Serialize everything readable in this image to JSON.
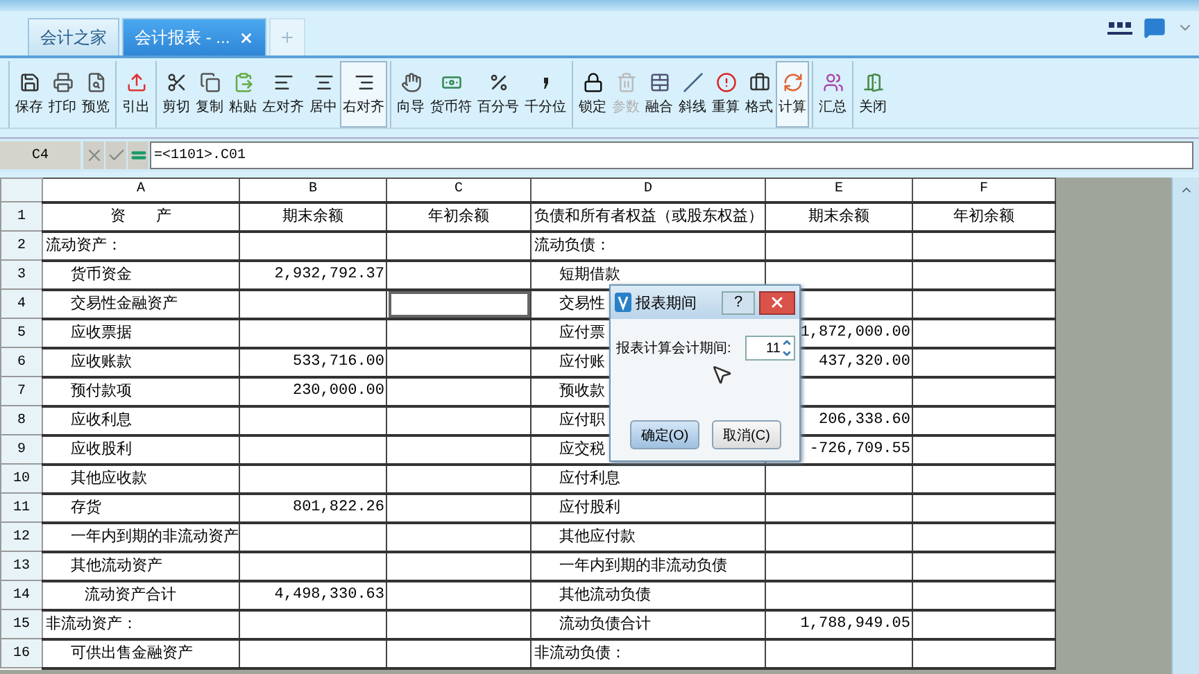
{
  "tabs": [
    {
      "label": "会计之家",
      "selected": false,
      "closable": false
    },
    {
      "label": "会计报表 - ...",
      "selected": true,
      "closable": true
    }
  ],
  "toolbar": [
    [
      {
        "label": "保存",
        "selected": false,
        "disabled": false
      },
      {
        "label": "打印",
        "selected": false,
        "disabled": false
      },
      {
        "label": "预览",
        "selected": false,
        "disabled": false
      }
    ],
    [
      {
        "label": "引出",
        "selected": false,
        "disabled": false
      }
    ],
    [
      {
        "label": "剪切",
        "selected": false,
        "disabled": false
      },
      {
        "label": "复制",
        "selected": false,
        "disabled": false
      },
      {
        "label": "粘贴",
        "selected": false,
        "disabled": false
      },
      {
        "label": "左对齐",
        "selected": false,
        "disabled": false
      },
      {
        "label": "居中",
        "selected": false,
        "disabled": false
      },
      {
        "label": "右对齐",
        "selected": true,
        "disabled": false
      }
    ],
    [
      {
        "label": "向导",
        "selected": false,
        "disabled": false
      },
      {
        "label": "货币符",
        "selected": false,
        "disabled": false
      },
      {
        "label": "百分号",
        "selected": false,
        "disabled": false
      },
      {
        "label": "千分位",
        "selected": false,
        "disabled": false
      }
    ],
    [
      {
        "label": "锁定",
        "selected": false,
        "disabled": false
      },
      {
        "label": "参数",
        "selected": false,
        "disabled": true
      },
      {
        "label": "融合",
        "selected": false,
        "disabled": false
      },
      {
        "label": "斜线",
        "selected": false,
        "disabled": false
      },
      {
        "label": "重算",
        "selected": false,
        "disabled": false
      },
      {
        "label": "格式",
        "selected": false,
        "disabled": false
      },
      {
        "label": "计算",
        "selected": true,
        "disabled": false
      }
    ],
    [
      {
        "label": "汇总",
        "selected": false,
        "disabled": false
      }
    ],
    [
      {
        "label": "关闭",
        "selected": false,
        "disabled": false
      }
    ]
  ],
  "formula_bar": {
    "cell_ref": "C4",
    "formula": "=<1101>.C01"
  },
  "columns": [
    "A",
    "B",
    "C",
    "D",
    "E",
    "F"
  ],
  "rows": [
    {
      "num": "1",
      "cells": [
        {
          "text": "资　　产",
          "kind": "header",
          "selected": false
        },
        {
          "text": "期末余额",
          "kind": "header",
          "selected": false
        },
        {
          "text": "年初余额",
          "kind": "header",
          "selected": false
        },
        {
          "text": "负债和所有者权益（或股东权益）",
          "kind": "header",
          "selected": false
        },
        {
          "text": "期末余额",
          "kind": "header",
          "selected": false
        },
        {
          "text": "年初余额",
          "kind": "header",
          "selected": false
        }
      ]
    },
    {
      "num": "2",
      "cells": [
        {
          "text": "流动资产：",
          "kind": "section",
          "selected": false
        },
        {
          "kind": "number",
          "selected": false
        },
        {
          "kind": "number",
          "selected": false
        },
        {
          "text": "流动负债：",
          "kind": "section",
          "selected": false
        },
        {
          "kind": "number",
          "selected": false
        },
        {
          "kind": "number",
          "selected": false
        }
      ]
    },
    {
      "num": "3",
      "cells": [
        {
          "text": "货币资金",
          "kind": "item",
          "selected": false
        },
        {
          "text": "2,932,792.37",
          "kind": "number",
          "selected": false
        },
        {
          "kind": "number",
          "selected": false
        },
        {
          "text": "短期借款",
          "kind": "item",
          "selected": false
        },
        {
          "kind": "number",
          "selected": false
        },
        {
          "kind": "number",
          "selected": false
        }
      ]
    },
    {
      "num": "4",
      "cells": [
        {
          "text": "交易性金融资产",
          "kind": "item",
          "selected": false
        },
        {
          "kind": "number",
          "selected": false
        },
        {
          "kind": "number",
          "selected": true
        },
        {
          "text": "交易性",
          "kind": "item",
          "selected": false
        },
        {
          "kind": "number",
          "selected": false
        },
        {
          "kind": "number",
          "selected": false
        }
      ]
    },
    {
      "num": "5",
      "cells": [
        {
          "text": "应收票据",
          "kind": "item",
          "selected": false
        },
        {
          "kind": "number",
          "selected": false
        },
        {
          "kind": "number",
          "selected": false
        },
        {
          "text": "应付票",
          "kind": "item",
          "selected": false
        },
        {
          "text": "1,872,000.00",
          "kind": "number",
          "selected": false
        },
        {
          "kind": "number",
          "selected": false
        }
      ]
    },
    {
      "num": "6",
      "cells": [
        {
          "text": "应收账款",
          "kind": "item",
          "selected": false
        },
        {
          "text": "533,716.00",
          "kind": "number",
          "selected": false
        },
        {
          "kind": "number",
          "selected": false
        },
        {
          "text": "应付账",
          "kind": "item",
          "selected": false
        },
        {
          "text": "437,320.00",
          "kind": "number",
          "selected": false
        },
        {
          "kind": "number",
          "selected": false
        }
      ]
    },
    {
      "num": "7",
      "cells": [
        {
          "text": "预付款项",
          "kind": "item",
          "selected": false
        },
        {
          "text": "230,000.00",
          "kind": "number",
          "selected": false
        },
        {
          "kind": "number",
          "selected": false
        },
        {
          "text": "预收款",
          "kind": "item",
          "selected": false
        },
        {
          "kind": "number",
          "selected": false
        },
        {
          "kind": "number",
          "selected": false
        }
      ]
    },
    {
      "num": "8",
      "cells": [
        {
          "text": "应收利息",
          "kind": "item",
          "selected": false
        },
        {
          "kind": "number",
          "selected": false
        },
        {
          "kind": "number",
          "selected": false
        },
        {
          "text": "应付职",
          "kind": "item",
          "selected": false
        },
        {
          "text": "206,338.60",
          "kind": "number",
          "selected": false
        },
        {
          "kind": "number",
          "selected": false
        }
      ]
    },
    {
      "num": "9",
      "cells": [
        {
          "text": "应收股利",
          "kind": "item",
          "selected": false
        },
        {
          "kind": "number",
          "selected": false
        },
        {
          "kind": "number",
          "selected": false
        },
        {
          "text": "应交税",
          "kind": "item",
          "selected": false
        },
        {
          "text": "-726,709.55",
          "kind": "number",
          "selected": false
        },
        {
          "kind": "number",
          "selected": false
        }
      ]
    },
    {
      "num": "10",
      "cells": [
        {
          "text": "其他应收款",
          "kind": "item",
          "selected": false
        },
        {
          "kind": "number",
          "selected": false
        },
        {
          "kind": "number",
          "selected": false
        },
        {
          "text": "应付利息",
          "kind": "item",
          "selected": false
        },
        {
          "kind": "number",
          "selected": false
        },
        {
          "kind": "number",
          "selected": false
        }
      ]
    },
    {
      "num": "11",
      "cells": [
        {
          "text": "存货",
          "kind": "item",
          "selected": false
        },
        {
          "text": "801,822.26",
          "kind": "number",
          "selected": false
        },
        {
          "kind": "number",
          "selected": false
        },
        {
          "text": "应付股利",
          "kind": "item",
          "selected": false
        },
        {
          "kind": "number",
          "selected": false
        },
        {
          "kind": "number",
          "selected": false
        }
      ]
    },
    {
      "num": "12",
      "cells": [
        {
          "text": "一年内到期的非流动资产",
          "kind": "item",
          "selected": false
        },
        {
          "kind": "number",
          "selected": false
        },
        {
          "kind": "number",
          "selected": false
        },
        {
          "text": "其他应付款",
          "kind": "item",
          "selected": false
        },
        {
          "kind": "number",
          "selected": false
        },
        {
          "kind": "number",
          "selected": false
        }
      ]
    },
    {
      "num": "13",
      "cells": [
        {
          "text": "其他流动资产",
          "kind": "item",
          "selected": false
        },
        {
          "kind": "number",
          "selected": false
        },
        {
          "kind": "number",
          "selected": false
        },
        {
          "text": "一年内到期的非流动负债",
          "kind": "item",
          "selected": false
        },
        {
          "kind": "number",
          "selected": false
        },
        {
          "kind": "number",
          "selected": false
        }
      ]
    },
    {
      "num": "14",
      "cells": [
        {
          "text": "流动资产合计",
          "kind": "total",
          "selected": false
        },
        {
          "text": "4,498,330.63",
          "kind": "number",
          "selected": false
        },
        {
          "kind": "number",
          "selected": false
        },
        {
          "text": "其他流动负债",
          "kind": "item",
          "selected": false
        },
        {
          "kind": "number",
          "selected": false
        },
        {
          "kind": "number",
          "selected": false
        }
      ]
    },
    {
      "num": "15",
      "cells": [
        {
          "text": "非流动资产：",
          "kind": "section",
          "selected": false
        },
        {
          "kind": "number",
          "selected": false
        },
        {
          "kind": "number",
          "selected": false
        },
        {
          "text": "流动负债合计",
          "kind": "item",
          "selected": false
        },
        {
          "text": "1,788,949.05",
          "kind": "number",
          "selected": false
        },
        {
          "kind": "number",
          "selected": false
        }
      ]
    },
    {
      "num": "16",
      "cells": [
        {
          "text": "可供出售金融资产",
          "kind": "item",
          "selected": false
        },
        {
          "kind": "number",
          "selected": false
        },
        {
          "kind": "number",
          "selected": false
        },
        {
          "text": "非流动负债：",
          "kind": "section",
          "selected": false
        },
        {
          "kind": "number",
          "selected": false
        },
        {
          "kind": "number",
          "selected": false
        }
      ]
    }
  ],
  "dialog": {
    "title": "报表期间",
    "help": "?",
    "label": "报表计算会计期间:",
    "value": "11",
    "buttons": [
      "确定(O)",
      "取消(C)"
    ]
  }
}
